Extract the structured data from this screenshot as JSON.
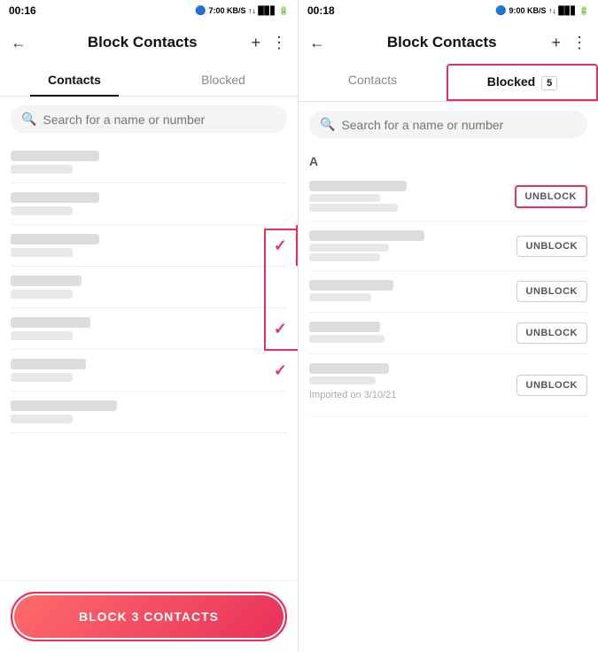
{
  "left_panel": {
    "status": {
      "time": "00:16",
      "icons": "🔵 7:00 ≋ ↑↓ .lll"
    },
    "header": {
      "title": "Block Contacts",
      "back_label": "←",
      "add_label": "+",
      "more_label": "⋮"
    },
    "tabs": [
      {
        "id": "contacts",
        "label": "Contacts",
        "active": true
      },
      {
        "id": "blocked",
        "label": "Blocked",
        "active": false
      }
    ],
    "search": {
      "placeholder": "Search for a name or number"
    },
    "contacts": [
      {
        "id": 1,
        "checked": false
      },
      {
        "id": 2,
        "checked": false
      },
      {
        "id": 3,
        "checked": true
      },
      {
        "id": 4,
        "checked": false
      },
      {
        "id": 5,
        "checked": true
      },
      {
        "id": 6,
        "checked": true
      },
      {
        "id": 7,
        "checked": false
      }
    ],
    "block_button": {
      "label": "BLOCK 3 CONTACTS"
    }
  },
  "right_panel": {
    "status": {
      "time": "00:18",
      "icons": "🔵 9:00 ≋ ↑↓ .lll"
    },
    "header": {
      "title": "Block Contacts",
      "back_label": "←",
      "add_label": "+",
      "more_label": "⋮"
    },
    "tabs": [
      {
        "id": "contacts",
        "label": "Contacts",
        "active": false
      },
      {
        "id": "blocked",
        "label": "Blocked",
        "active": true,
        "badge": "5"
      }
    ],
    "search": {
      "placeholder": "Search for a name or number"
    },
    "section_a": "A",
    "blocked_contacts": [
      {
        "id": 1,
        "unblock_label": "UNBLOCK",
        "highlighted": true,
        "import_note": ""
      },
      {
        "id": 2,
        "unblock_label": "UNBLOCK",
        "highlighted": false,
        "import_note": ""
      },
      {
        "id": 3,
        "unblock_label": "UNBLOCK",
        "highlighted": false,
        "import_note": ""
      },
      {
        "id": 4,
        "unblock_label": "UNBLOCK",
        "highlighted": false,
        "import_note": ""
      },
      {
        "id": 5,
        "unblock_label": "UNBLOCK",
        "highlighted": false,
        "import_note": "Imported on 3/10/21"
      }
    ]
  }
}
